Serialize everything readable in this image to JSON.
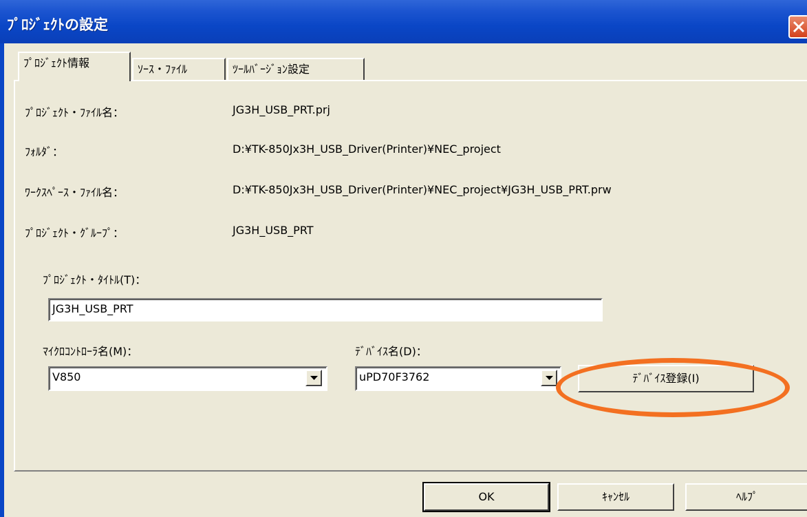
{
  "window": {
    "title": "ﾌﾟﾛｼﾞｪｸﾄの設定"
  },
  "tabs": [
    {
      "label": "ﾌﾟﾛｼﾞｪｸﾄ情報",
      "active": true
    },
    {
      "label": "ｿｰｽ・ﾌｧｲﾙ",
      "active": false
    },
    {
      "label": "ﾂｰﾙﾊﾞｰｼﾞｮﾝ設定",
      "active": false
    }
  ],
  "info": {
    "project_file_label": "ﾌﾟﾛｼﾞｪｸﾄ・ﾌｧｲﾙ名：",
    "project_file_value": "JG3H_USB_PRT.prj",
    "folder_label": "ﾌｫﾙﾀﾞ：",
    "folder_value": "D:¥TK-850Jx3H_USB_Driver(Printer)¥NEC_project",
    "workspace_label": "ﾜｰｸｽﾍﾟｰｽ・ﾌｧｲﾙ名：",
    "workspace_value": "D:¥TK-850Jx3H_USB_Driver(Printer)¥NEC_project¥JG3H_USB_PRT.prw",
    "group_label": "ﾌﾟﾛｼﾞｪｸﾄ・ｸﾞﾙｰﾌﾟ：",
    "group_value": "JG3H_USB_PRT"
  },
  "title_field": {
    "label": "ﾌﾟﾛｼﾞｪｸﾄ・ﾀｲﾄﾙ(T)：",
    "value": "JG3H_USB_PRT"
  },
  "microcontroller": {
    "label": "ﾏｲｸﾛｺﾝﾄﾛｰﾗ名(M)：",
    "value": "V850"
  },
  "device": {
    "label": "ﾃﾞﾊﾞｲｽ名(D)：",
    "value": "uPD70F3762",
    "register_button": "ﾃﾞﾊﾞｲｽ登録(I)"
  },
  "buttons": {
    "ok": "OK",
    "cancel": "ｷｬﾝｾﾙ",
    "help": "ﾍﾙﾌﾟ"
  },
  "colors": {
    "titlebar": "#0A46C6",
    "face": "#ECE9D8",
    "highlight": "#F37021"
  }
}
